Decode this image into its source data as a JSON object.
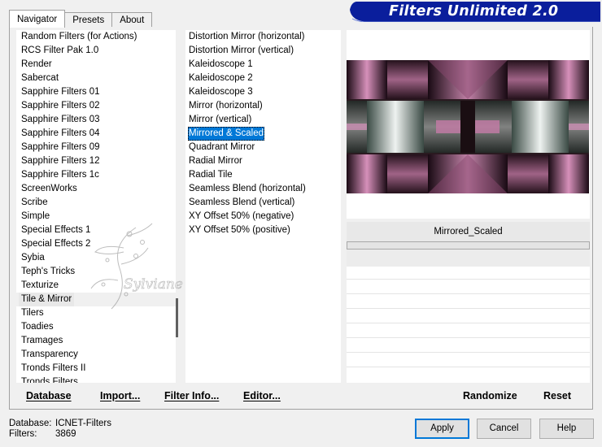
{
  "tabs": [
    {
      "label": "Navigator",
      "active": true
    },
    {
      "label": "Presets",
      "active": false
    },
    {
      "label": "About",
      "active": false
    }
  ],
  "header": {
    "title": "Filters Unlimited 2.0"
  },
  "categories": [
    {
      "label": "Random Filters (for Actions)"
    },
    {
      "label": "RCS Filter Pak 1.0"
    },
    {
      "label": "Render"
    },
    {
      "label": "Sabercat"
    },
    {
      "label": "Sapphire Filters 01"
    },
    {
      "label": "Sapphire Filters 02"
    },
    {
      "label": "Sapphire Filters 03"
    },
    {
      "label": "Sapphire Filters 04"
    },
    {
      "label": "Sapphire Filters 09"
    },
    {
      "label": "Sapphire Filters 12"
    },
    {
      "label": "Sapphire Filters 1c"
    },
    {
      "label": "ScreenWorks"
    },
    {
      "label": "Scribe"
    },
    {
      "label": "Simple"
    },
    {
      "label": "Special Effects 1"
    },
    {
      "label": "Special Effects 2"
    },
    {
      "label": "Sybia"
    },
    {
      "label": "Teph's Tricks"
    },
    {
      "label": "Texturize"
    },
    {
      "label": "Tile & Mirror",
      "highlighted": true
    },
    {
      "label": "Tilers"
    },
    {
      "label": "Toadies"
    },
    {
      "label": "Tramages"
    },
    {
      "label": "Transparency"
    },
    {
      "label": "Tronds Filters II"
    },
    {
      "label": "Tronds Filters"
    }
  ],
  "filters": [
    {
      "label": "Distortion Mirror (horizontal)"
    },
    {
      "label": "Distortion Mirror (vertical)"
    },
    {
      "label": "Kaleidoscope 1"
    },
    {
      "label": "Kaleidoscope 2"
    },
    {
      "label": "Kaleidoscope 3"
    },
    {
      "label": "Mirror (horizontal)"
    },
    {
      "label": "Mirror (vertical)"
    },
    {
      "label": "Mirrored & Scaled",
      "selected": true
    },
    {
      "label": "Quadrant Mirror"
    },
    {
      "label": "Radial Mirror"
    },
    {
      "label": "Radial Tile"
    },
    {
      "label": "Seamless Blend (horizontal)"
    },
    {
      "label": "Seamless Blend (vertical)"
    },
    {
      "label": "XY Offset 50% (negative)"
    },
    {
      "label": "XY Offset 50% (positive)"
    }
  ],
  "preview": {
    "filter_name": "Mirrored_Scaled"
  },
  "toolbar": {
    "database_label": "Database",
    "import_label": "Import...",
    "filter_info_label": "Filter Info...",
    "editor_label": "Editor...",
    "randomize_label": "Randomize",
    "reset_label": "Reset"
  },
  "status": {
    "database_label": "Database:",
    "database_value": "ICNET-Filters",
    "filters_label": "Filters:",
    "filters_value": "3869"
  },
  "buttons": {
    "apply": "Apply",
    "cancel": "Cancel",
    "help": "Help"
  },
  "watermark": {
    "text": "Sylviane"
  },
  "colors": {
    "banner_blue": "#0a1e9c",
    "selection": "#0078d7",
    "preview_pink": "#c47aa6"
  }
}
